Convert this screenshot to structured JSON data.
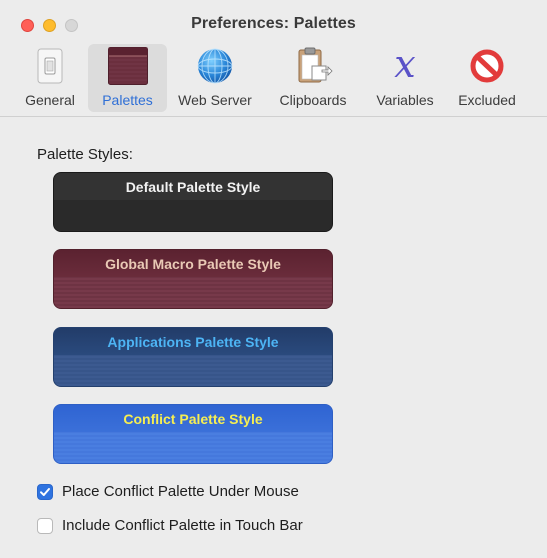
{
  "window": {
    "title": "Preferences: Palettes"
  },
  "toolbar": {
    "items": [
      {
        "label": "General",
        "icon": "switch-icon"
      },
      {
        "label": "Palettes",
        "icon": "palette-swatch-icon"
      },
      {
        "label": "Web Server",
        "icon": "globe-icon"
      },
      {
        "label": "Clipboards",
        "icon": "clipboard-icon"
      },
      {
        "label": "Variables",
        "icon": "variable-x-icon"
      },
      {
        "label": "Excluded",
        "icon": "prohibited-icon"
      }
    ],
    "selected": "Palettes"
  },
  "palettes": {
    "section_label": "Palette Styles:",
    "styles": [
      {
        "label": "Default Palette Style",
        "text_color": "#f2f2f2",
        "color": "#2b2b2b"
      },
      {
        "label": "Global Macro Palette Style",
        "text_color": "#e9c9b5",
        "color": "#6b2f3e"
      },
      {
        "label": "Applications Palette Style",
        "text_color": "#4db4f4",
        "color": "#2f4d80"
      },
      {
        "label": "Conflict Palette Style",
        "text_color": "#f6ee52",
        "color": "#3a6ed8"
      }
    ]
  },
  "options": {
    "place_under_mouse": {
      "label": "Place Conflict Palette Under Mouse",
      "checked": true
    },
    "include_touch_bar": {
      "label": "Include Conflict Palette in Touch Bar",
      "checked": false
    }
  },
  "colors": {
    "accent": "#2f73e0",
    "window_bg": "#ececec"
  }
}
